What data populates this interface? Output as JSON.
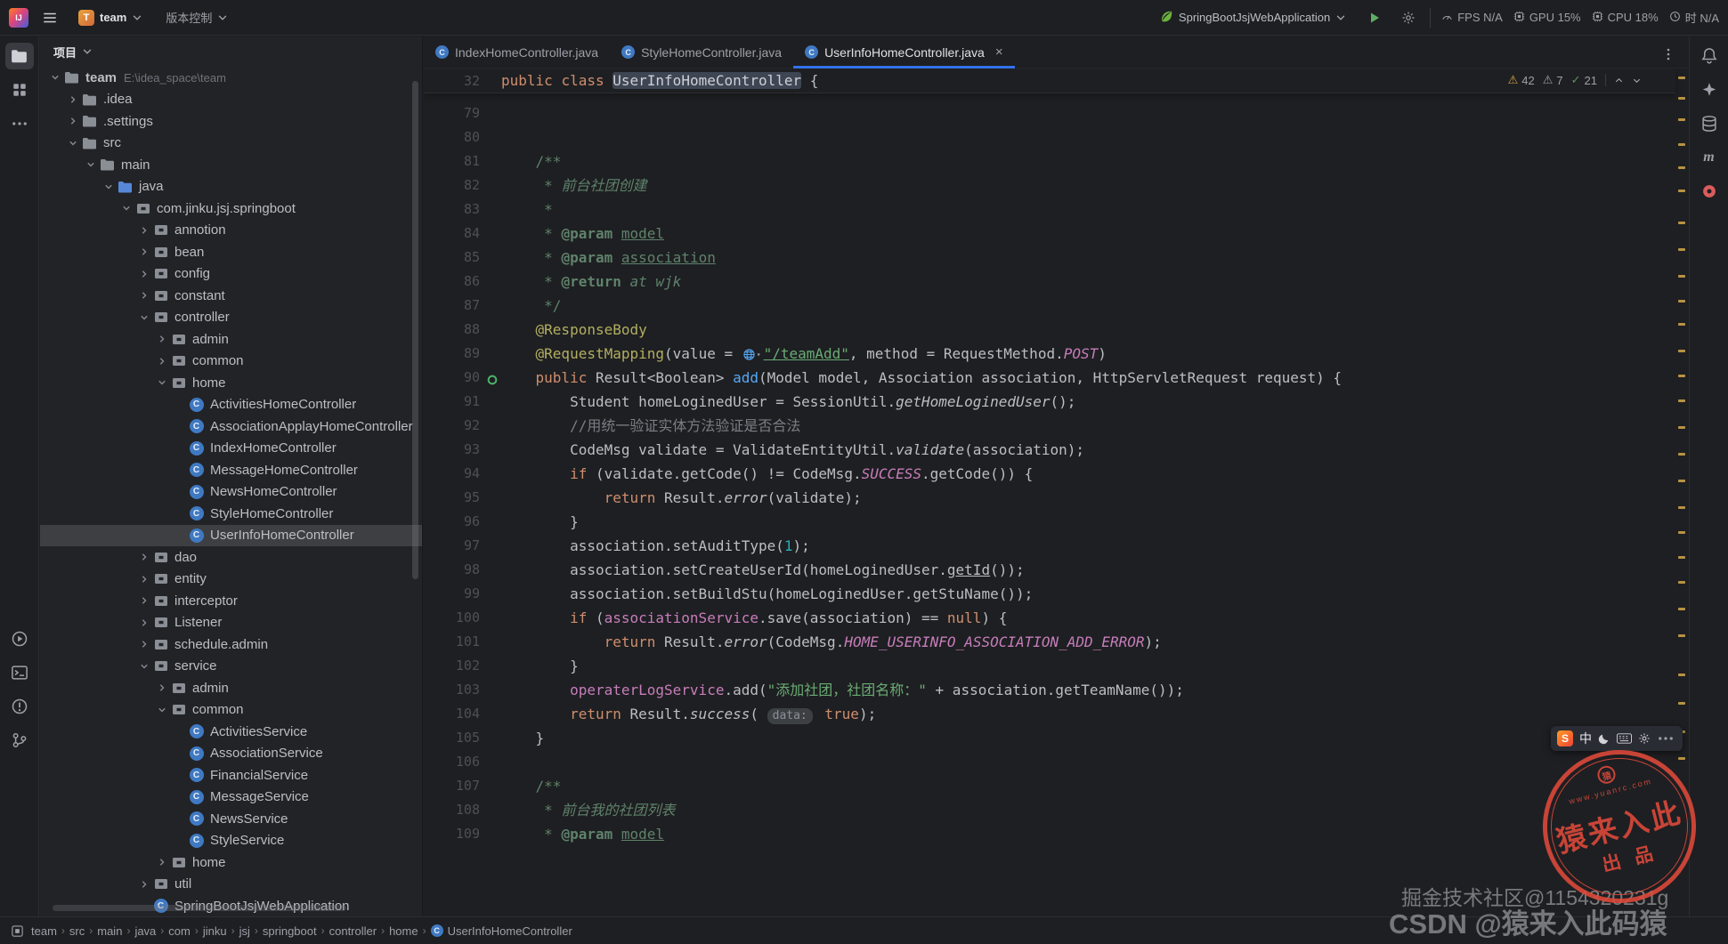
{
  "window": {
    "app_icon": "IJ",
    "project_widget": {
      "label": "team",
      "icon_letter": "T"
    },
    "vcs_widget": "版本控制",
    "run_config": "SpringBootJsjWebApplication",
    "perf": [
      {
        "icon": "gauge",
        "label": "FPS N/A"
      },
      {
        "icon": "gpu",
        "label": "GPU 15%"
      },
      {
        "icon": "gpu",
        "label": "CPU 18%"
      },
      {
        "icon": "clock",
        "label": "时 N/A"
      }
    ]
  },
  "left_strip": {
    "top": [
      "project-folder",
      "structure",
      "more"
    ],
    "bottom": [
      "run",
      "terminal",
      "problems",
      "git"
    ]
  },
  "right_strip": [
    "notifications",
    "ai-assistant",
    "database",
    "maven",
    "plugin"
  ],
  "project_panel": {
    "title": "项目",
    "tree": [
      {
        "label": "team",
        "path": "E:\\idea_space\\team",
        "lv": 0,
        "icon": "folder",
        "chev": "v"
      },
      {
        "label": ".idea",
        "lv": 1,
        "icon": "folder",
        "chev": ">"
      },
      {
        "label": ".settings",
        "lv": 1,
        "icon": "folder",
        "chev": ">"
      },
      {
        "label": "src",
        "lv": 1,
        "icon": "folder",
        "chev": "v"
      },
      {
        "label": "main",
        "lv": 2,
        "icon": "folder",
        "chev": "v"
      },
      {
        "label": "java",
        "lv": 3,
        "icon": "srcfolder",
        "chev": "v"
      },
      {
        "label": "com.jinku.jsj.springboot",
        "lv": 4,
        "icon": "pkg",
        "chev": "v"
      },
      {
        "label": "annotion",
        "lv": 5,
        "icon": "pkg",
        "chev": ">"
      },
      {
        "label": "bean",
        "lv": 5,
        "icon": "pkg",
        "chev": ">"
      },
      {
        "label": "config",
        "lv": 5,
        "icon": "pkg",
        "chev": ">"
      },
      {
        "label": "constant",
        "lv": 5,
        "icon": "pkg",
        "chev": ">"
      },
      {
        "label": "controller",
        "lv": 5,
        "icon": "pkg",
        "chev": "v"
      },
      {
        "label": "admin",
        "lv": 6,
        "icon": "pkg",
        "chev": ">"
      },
      {
        "label": "common",
        "lv": 6,
        "icon": "pkg",
        "chev": ">"
      },
      {
        "label": "home",
        "lv": 6,
        "icon": "pkg",
        "chev": "v"
      },
      {
        "label": "ActivitiesHomeController",
        "lv": 7,
        "icon": "class"
      },
      {
        "label": "AssociationApplayHomeController",
        "lv": 7,
        "icon": "class"
      },
      {
        "label": "IndexHomeController",
        "lv": 7,
        "icon": "class"
      },
      {
        "label": "MessageHomeController",
        "lv": 7,
        "icon": "class"
      },
      {
        "label": "NewsHomeController",
        "lv": 7,
        "icon": "class"
      },
      {
        "label": "StyleHomeController",
        "lv": 7,
        "icon": "class"
      },
      {
        "label": "UserInfoHomeController",
        "lv": 7,
        "icon": "class",
        "selected": true
      },
      {
        "label": "dao",
        "lv": 5,
        "icon": "pkg",
        "chev": ">"
      },
      {
        "label": "entity",
        "lv": 5,
        "icon": "pkg",
        "chev": ">"
      },
      {
        "label": "interceptor",
        "lv": 5,
        "icon": "pkg",
        "chev": ">"
      },
      {
        "label": "Listener",
        "lv": 5,
        "icon": "pkg",
        "chev": ">"
      },
      {
        "label": "schedule.admin",
        "lv": 5,
        "icon": "pkg",
        "chev": ">"
      },
      {
        "label": "service",
        "lv": 5,
        "icon": "pkg",
        "chev": "v"
      },
      {
        "label": "admin",
        "lv": 6,
        "icon": "pkg",
        "chev": ">"
      },
      {
        "label": "common",
        "lv": 6,
        "icon": "pkg",
        "chev": "v"
      },
      {
        "label": "ActivitiesService",
        "lv": 7,
        "icon": "class"
      },
      {
        "label": "AssociationService",
        "lv": 7,
        "icon": "class"
      },
      {
        "label": "FinancialService",
        "lv": 7,
        "icon": "class"
      },
      {
        "label": "MessageService",
        "lv": 7,
        "icon": "class"
      },
      {
        "label": "NewsService",
        "lv": 7,
        "icon": "class"
      },
      {
        "label": "StyleService",
        "lv": 7,
        "icon": "class"
      },
      {
        "label": "home",
        "lv": 6,
        "icon": "pkg",
        "chev": ">"
      },
      {
        "label": "util",
        "lv": 5,
        "icon": "pkg",
        "chev": ">"
      },
      {
        "label": "SpringBootJsjWebApplication",
        "lv": 5,
        "icon": "class"
      }
    ]
  },
  "tabs": {
    "close_glyph": "×",
    "items": [
      {
        "label": "IndexHomeController.java",
        "active": false
      },
      {
        "label": "StyleHomeController.java",
        "active": false
      },
      {
        "label": "UserInfoHomeController.java",
        "active": true
      }
    ]
  },
  "editor": {
    "sticky": {
      "num": "32",
      "i": 0,
      "t": [
        [
          "k",
          "public"
        ],
        [
          "d",
          " "
        ],
        [
          "k",
          "class"
        ],
        [
          "d",
          " "
        ],
        [
          "hl",
          "UserInfoHomeController"
        ],
        [
          "d",
          " {"
        ]
      ]
    },
    "inspections": [
      {
        "glyph": "⚠",
        "color": "#d9a343",
        "count": "42"
      },
      {
        "glyph": "⚠",
        "color": "#9da0a8",
        "count": "7"
      },
      {
        "glyph": "✓",
        "color": "#57965c",
        "count": "21"
      }
    ],
    "stripe_marks": [
      0.009,
      0.034,
      0.059,
      0.088,
      0.115,
      0.143,
      0.18,
      0.212,
      0.243,
      0.273,
      0.3,
      0.331,
      0.361,
      0.39,
      0.421,
      0.453,
      0.484,
      0.516,
      0.545,
      0.574,
      0.604,
      0.635,
      0.667,
      0.713,
      0.746,
      0.78,
      0.811
    ],
    "lines": [
      {
        "n": "79",
        "i": 0,
        "t": []
      },
      {
        "n": "80",
        "i": 0,
        "t": []
      },
      {
        "n": "81",
        "i": 4,
        "t": [
          [
            "dc",
            "/**"
          ]
        ]
      },
      {
        "n": "82",
        "i": 5,
        "t": [
          [
            "dc",
            "* "
          ],
          [
            "dci",
            "前台社团创建"
          ]
        ]
      },
      {
        "n": "83",
        "i": 5,
        "t": [
          [
            "dc",
            "*"
          ]
        ]
      },
      {
        "n": "84",
        "i": 5,
        "t": [
          [
            "dc",
            "* "
          ],
          [
            "dt",
            "@param"
          ],
          [
            "dc",
            " "
          ],
          [
            "dp",
            "model"
          ]
        ]
      },
      {
        "n": "85",
        "i": 5,
        "t": [
          [
            "dc",
            "* "
          ],
          [
            "dt",
            "@param"
          ],
          [
            "dc",
            " "
          ],
          [
            "dp",
            "association"
          ]
        ]
      },
      {
        "n": "86",
        "i": 5,
        "t": [
          [
            "dc",
            "* "
          ],
          [
            "dt",
            "@return"
          ],
          [
            "dc",
            " "
          ],
          [
            "dci",
            "at wjk"
          ]
        ]
      },
      {
        "n": "87",
        "i": 5,
        "t": [
          [
            "dc",
            "*/"
          ]
        ]
      },
      {
        "n": "88",
        "i": 4,
        "t": [
          [
            "a",
            "@ResponseBody"
          ]
        ]
      },
      {
        "n": "89",
        "i": 4,
        "t": [
          [
            "a",
            "@RequestMapping"
          ],
          [
            "d",
            "(value = "
          ],
          [
            "g",
            ""
          ],
          [
            "sl",
            "\"/teamAdd\""
          ],
          [
            "d",
            ", method = RequestMethod."
          ],
          [
            "sf",
            "POST"
          ],
          [
            "d",
            ")"
          ]
        ]
      },
      {
        "n": "90",
        "i": 4,
        "gicon": true,
        "t": [
          [
            "k",
            "public"
          ],
          [
            "d",
            " Result<Boolean> "
          ],
          [
            "m",
            "add"
          ],
          [
            "d",
            "(Model model, Association association, HttpServletRequest request) {"
          ]
        ]
      },
      {
        "n": "91",
        "i": 8,
        "t": [
          [
            "d",
            "Student homeLoginedUser = SessionUtil."
          ],
          [
            "sm",
            "getHomeLoginedUser"
          ],
          [
            "d",
            "();"
          ]
        ]
      },
      {
        "n": "92",
        "i": 8,
        "t": [
          [
            "c",
            "//用统一验证实体方法验证是否合法"
          ]
        ]
      },
      {
        "n": "93",
        "i": 8,
        "t": [
          [
            "d",
            "CodeMsg validate = ValidateEntityUtil."
          ],
          [
            "sm",
            "validate"
          ],
          [
            "d",
            "(association);"
          ]
        ]
      },
      {
        "n": "94",
        "i": 8,
        "t": [
          [
            "k",
            "if"
          ],
          [
            "d",
            " (validate.getCode() != CodeMsg."
          ],
          [
            "sf",
            "SUCCESS"
          ],
          [
            "d",
            ".getCode()) {"
          ]
        ]
      },
      {
        "n": "95",
        "i": 12,
        "t": [
          [
            "k",
            "return"
          ],
          [
            "d",
            " Result."
          ],
          [
            "sm",
            "error"
          ],
          [
            "d",
            "(validate);"
          ]
        ]
      },
      {
        "n": "96",
        "i": 8,
        "t": [
          [
            "d",
            "}"
          ]
        ]
      },
      {
        "n": "97",
        "i": 8,
        "t": [
          [
            "d",
            "association.setAuditType("
          ],
          [
            "n",
            "1"
          ],
          [
            "d",
            ");"
          ]
        ]
      },
      {
        "n": "98",
        "i": 8,
        "t": [
          [
            "d",
            "association.setCreateUserId(homeLoginedUser."
          ],
          [
            "u",
            "getId"
          ],
          [
            "d",
            "());"
          ]
        ]
      },
      {
        "n": "99",
        "i": 8,
        "t": [
          [
            "d",
            "association.setBuildStu(homeLoginedUser.getStuName());"
          ]
        ]
      },
      {
        "n": "100",
        "i": 8,
        "t": [
          [
            "k",
            "if"
          ],
          [
            "d",
            " ("
          ],
          [
            "f",
            "associationService"
          ],
          [
            "d",
            ".save(association) == "
          ],
          [
            "k",
            "null"
          ],
          [
            "d",
            ") {"
          ]
        ]
      },
      {
        "n": "101",
        "i": 12,
        "t": [
          [
            "k",
            "return"
          ],
          [
            "d",
            " Result."
          ],
          [
            "sm",
            "error"
          ],
          [
            "d",
            "(CodeMsg."
          ],
          [
            "sf",
            "HOME_USERINFO_ASSOCIATION_ADD_ERROR"
          ],
          [
            "d",
            ");"
          ]
        ]
      },
      {
        "n": "102",
        "i": 8,
        "t": [
          [
            "d",
            "}"
          ]
        ]
      },
      {
        "n": "103",
        "i": 8,
        "t": [
          [
            "f",
            "operaterLogService"
          ],
          [
            "d",
            ".add("
          ],
          [
            "s",
            "\"添加社团，社团名称：\""
          ],
          [
            "d",
            " + association.getTeamName());"
          ]
        ]
      },
      {
        "n": "104",
        "i": 8,
        "t": [
          [
            "k",
            "return"
          ],
          [
            "d",
            " Result."
          ],
          [
            "sm",
            "success"
          ],
          [
            "d",
            "( "
          ],
          [
            "chip",
            "data:"
          ],
          [
            "d",
            " "
          ],
          [
            "k",
            "true"
          ],
          [
            "d",
            ");"
          ]
        ]
      },
      {
        "n": "105",
        "i": 4,
        "t": [
          [
            "d",
            "}"
          ]
        ]
      },
      {
        "n": "106",
        "i": 0,
        "t": []
      },
      {
        "n": "107",
        "i": 4,
        "t": [
          [
            "dc",
            "/**"
          ]
        ]
      },
      {
        "n": "108",
        "i": 5,
        "t": [
          [
            "dc",
            "* "
          ],
          [
            "dci",
            "前台我的社团列表"
          ]
        ]
      },
      {
        "n": "109",
        "i": 5,
        "t": [
          [
            "dc",
            "* "
          ],
          [
            "dt",
            "@param"
          ],
          [
            "dc",
            " "
          ],
          [
            "dp",
            "model"
          ]
        ]
      }
    ]
  },
  "status_bar": {
    "breadcrumbs": [
      "team",
      "src",
      "main",
      "java",
      "com",
      "jinku",
      "jsj",
      "springboot",
      "controller",
      "home",
      "UserInfoHomeController"
    ]
  },
  "overlays": {
    "ime": {
      "logo": "S",
      "lang": "中"
    },
    "stamp": {
      "logo": "猿",
      "url": "www.yuanrc.com",
      "line1": "猿来入此",
      "line2": "出品"
    },
    "watermarks": {
      "juejin": "掘金技术社区@1154320231g",
      "csdn": "CSDN @猿来入此码猿"
    }
  }
}
